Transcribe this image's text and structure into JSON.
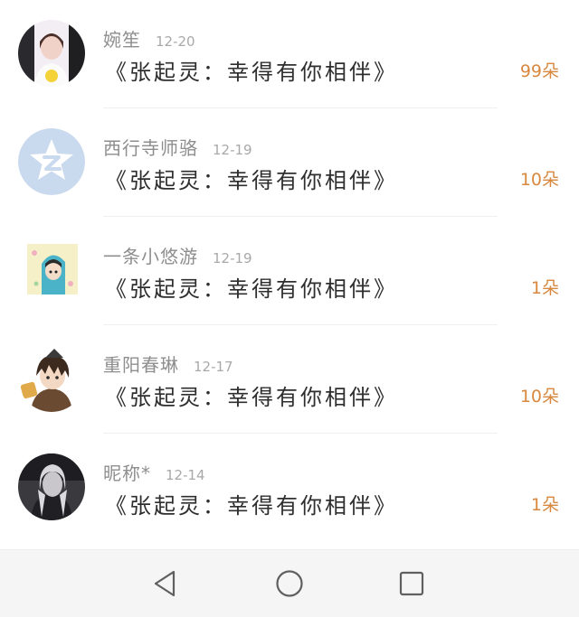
{
  "gift_list": {
    "rows": [
      {
        "name": "婉笙",
        "date": "12-20",
        "gift": "《张起灵：幸得有你相伴》",
        "count": "99朵"
      },
      {
        "name": "西行寺师骆",
        "date": "12-19",
        "gift": "《张起灵：幸得有你相伴》",
        "count": "10朵"
      },
      {
        "name": "一条小悠游",
        "date": "12-19",
        "gift": "《张起灵：幸得有你相伴》",
        "count": "1朵"
      },
      {
        "name": "重阳春琳",
        "date": "12-17",
        "gift": "《张起灵：幸得有你相伴》",
        "count": "10朵"
      },
      {
        "name": "昵称*",
        "date": "12-14",
        "gift": "《张起灵：幸得有你相伴》",
        "count": "1朵"
      }
    ]
  },
  "colors": {
    "count_accent": "#d8883f",
    "name_gray": "#8e8e8e",
    "qq_avatar_blue": "#c9d9ee"
  },
  "navigation_bar": {
    "back_icon": "triangle-back-icon",
    "home_icon": "circle-home-icon",
    "recents_icon": "square-recents-icon"
  }
}
